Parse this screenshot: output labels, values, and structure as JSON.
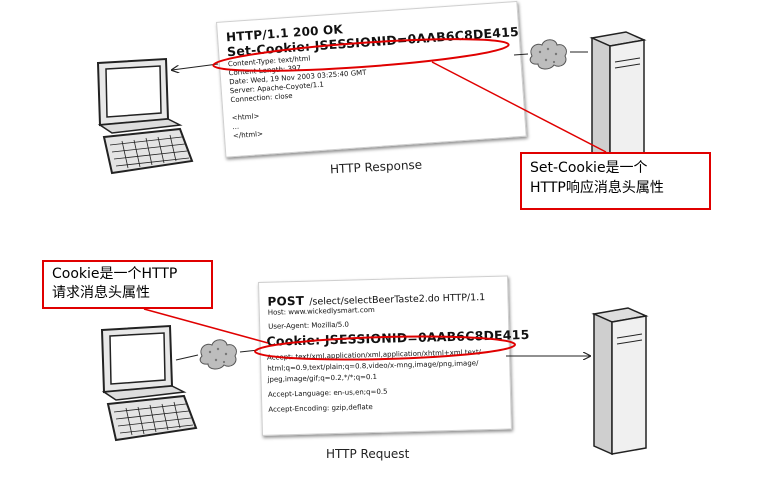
{
  "response": {
    "status_line": "HTTP/1.1 200 OK",
    "set_cookie_line": "Set-Cookie: JSESSIONID=0AAB6C8DE415",
    "headers": [
      "Content-Type: text/html",
      "Content-Length: 397",
      "Date: Wed, 19 Nov 2003 03:25:40 GMT",
      "Server: Apache-Coyote/1.1",
      "Connection: close"
    ],
    "body_lines": [
      "<html>",
      "...",
      "</html>"
    ],
    "caption": "HTTP Response",
    "note_line1": "Set-Cookie是一个",
    "note_line2": "HTTP响应消息头属性"
  },
  "request": {
    "method": "POST",
    "request_line_rest": "/select/selectBeerTaste2.do  HTTP/1.1",
    "host": "Host: www.wickedlysmart.com",
    "user_agent": "User-Agent: Mozilla/5.0",
    "cookie_line": "Cookie: JSESSIONID=0AAB6C8DE415",
    "headers": [
      "Accept: text/xml,application/xml,application/xhtml+xml,text/",
      "html;q=0.9,text/plain;q=0.8,video/x-mng,image/png,image/",
      "jpeg,image/gif;q=0.2,*/*;q=0.1",
      "Accept-Language: en-us,en;q=0.5",
      "Accept-Encoding: gzip,deflate"
    ],
    "caption": "HTTP Request",
    "note_line1": "Cookie是一个HTTP",
    "note_line2": "请求消息头属性"
  },
  "colors": {
    "highlight": "#e00000",
    "ink": "#111111"
  },
  "icons": [
    "client-computer-icon",
    "server-tower-icon",
    "network-cloud-icon"
  ]
}
